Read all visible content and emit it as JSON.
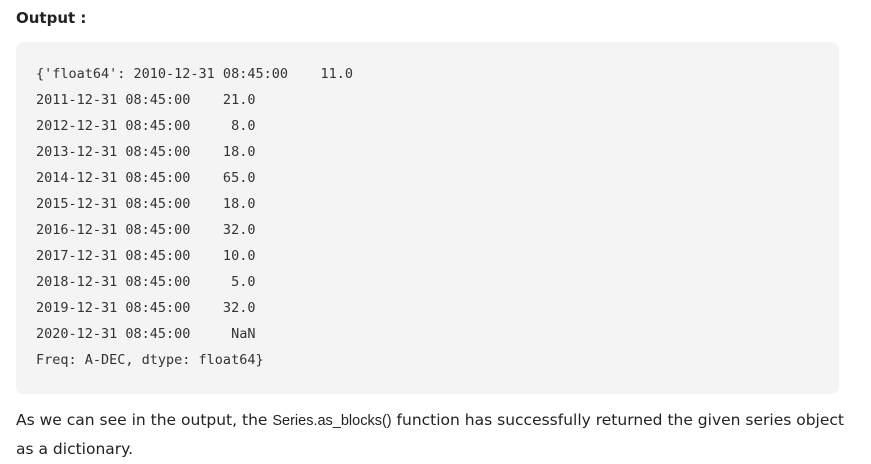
{
  "heading": "Output :",
  "code_lines": [
    "{'float64': 2010-12-31 08:45:00    11.0",
    "2011-12-31 08:45:00    21.0",
    "2012-12-31 08:45:00     8.0",
    "2013-12-31 08:45:00    18.0",
    "2014-12-31 08:45:00    65.0",
    "2015-12-31 08:45:00    18.0",
    "2016-12-31 08:45:00    32.0",
    "2017-12-31 08:45:00    10.0",
    "2018-12-31 08:45:00     5.0",
    "2019-12-31 08:45:00    32.0",
    "2020-12-31 08:45:00     NaN",
    "Freq: A-DEC, dtype: float64}"
  ],
  "paragraph": {
    "before": "As we can see in the output, the ",
    "code": "Series.as_blocks()",
    "after": " function has successfully returned the given series object as a dictionary."
  }
}
